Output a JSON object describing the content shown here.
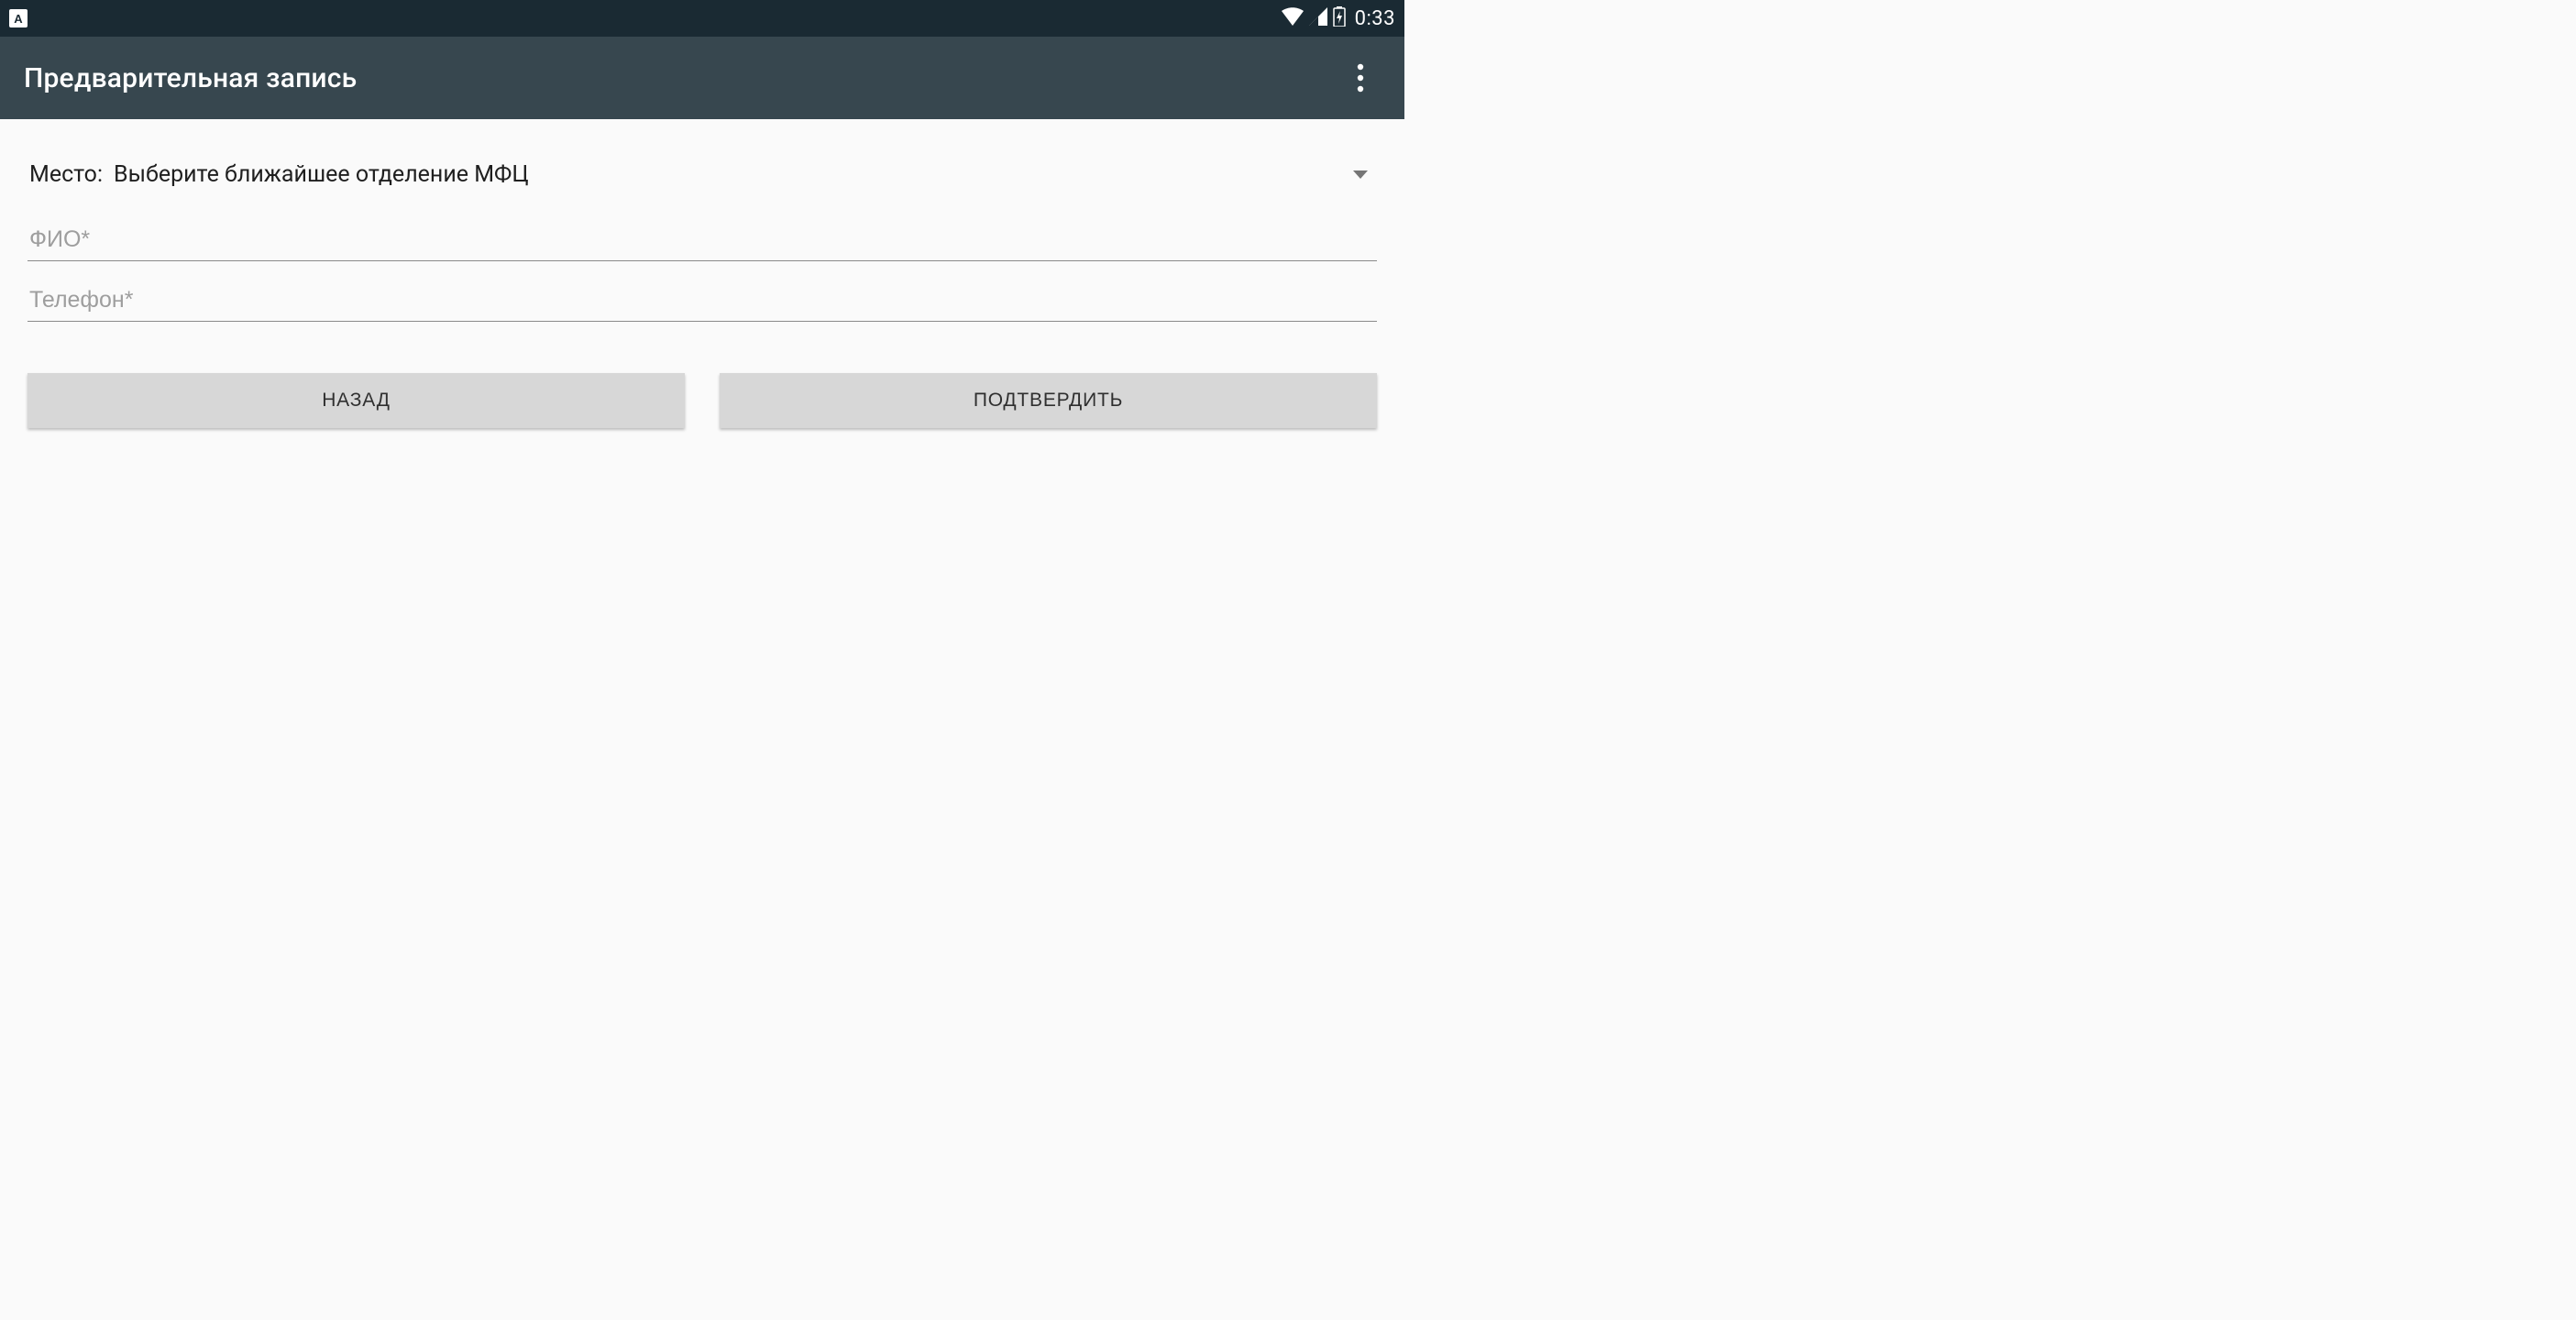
{
  "statusbar": {
    "time": "0:33",
    "keyboard_glyph": "A"
  },
  "appbar": {
    "title": "Предварительная запись"
  },
  "form": {
    "place_label": "Место:",
    "place_value": "Выберите ближайшее отделение МФЦ",
    "fio_placeholder": "ФИО*",
    "phone_placeholder": "Телефон*"
  },
  "buttons": {
    "back": "НАЗАД",
    "confirm": "ПОДТВЕРДИТЬ"
  }
}
